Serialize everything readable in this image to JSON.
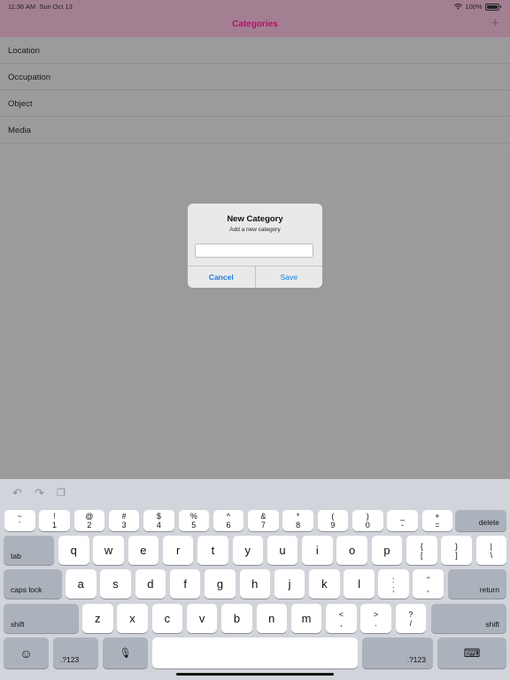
{
  "status_bar": {
    "time": "11:36 AM",
    "date": "Sun Oct 13",
    "battery": "100%"
  },
  "nav": {
    "title": "Categories",
    "add_icon": "plus-icon"
  },
  "categories": [
    "Location",
    "Occupation",
    "Object",
    "Media"
  ],
  "alert": {
    "title": "New Category",
    "message": "Add a new category",
    "input_value": "",
    "cancel_label": "Cancel",
    "save_label": "Save"
  },
  "keyboard": {
    "toolbar_icons": [
      "undo-icon",
      "redo-icon",
      "paste-icon"
    ],
    "row1": [
      {
        "top": "~",
        "bottom": "`"
      },
      {
        "top": "!",
        "bottom": "1"
      },
      {
        "top": "@",
        "bottom": "2"
      },
      {
        "top": "#",
        "bottom": "3"
      },
      {
        "top": "$",
        "bottom": "4"
      },
      {
        "top": "%",
        "bottom": "5"
      },
      {
        "top": "^",
        "bottom": "6"
      },
      {
        "top": "&",
        "bottom": "7"
      },
      {
        "top": "*",
        "bottom": "8"
      },
      {
        "top": "(",
        "bottom": "9"
      },
      {
        "top": ")",
        "bottom": "0"
      },
      {
        "top": "_",
        "bottom": "-"
      },
      {
        "top": "+",
        "bottom": "="
      }
    ],
    "delete_label": "delete",
    "tab_label": "tab",
    "row2_letters": [
      "q",
      "w",
      "e",
      "r",
      "t",
      "y",
      "u",
      "i",
      "o",
      "p"
    ],
    "row2_symbols": [
      {
        "top": "{",
        "bottom": "["
      },
      {
        "top": "}",
        "bottom": "]"
      },
      {
        "top": "|",
        "bottom": "\\"
      }
    ],
    "caps_label": "caps lock",
    "row3_letters": [
      "a",
      "s",
      "d",
      "f",
      "g",
      "h",
      "j",
      "k",
      "l"
    ],
    "row3_symbols": [
      {
        "top": ":",
        "bottom": ";"
      },
      {
        "top": "\"",
        "bottom": ","
      }
    ],
    "return_label": "return",
    "shift_label": "shift",
    "row4_letters": [
      "z",
      "x",
      "c",
      "v",
      "b",
      "n",
      "m"
    ],
    "row4_symbols": [
      {
        "top": "<",
        "bottom": ","
      },
      {
        "top": ">",
        "bottom": "."
      },
      {
        "top": "?",
        "bottom": "/"
      }
    ],
    "numbers_label": ".?123",
    "emoji_icon": "emoji-icon",
    "mic_icon": "microphone-icon",
    "dismiss_icon": "keyboard-dismiss-icon"
  }
}
